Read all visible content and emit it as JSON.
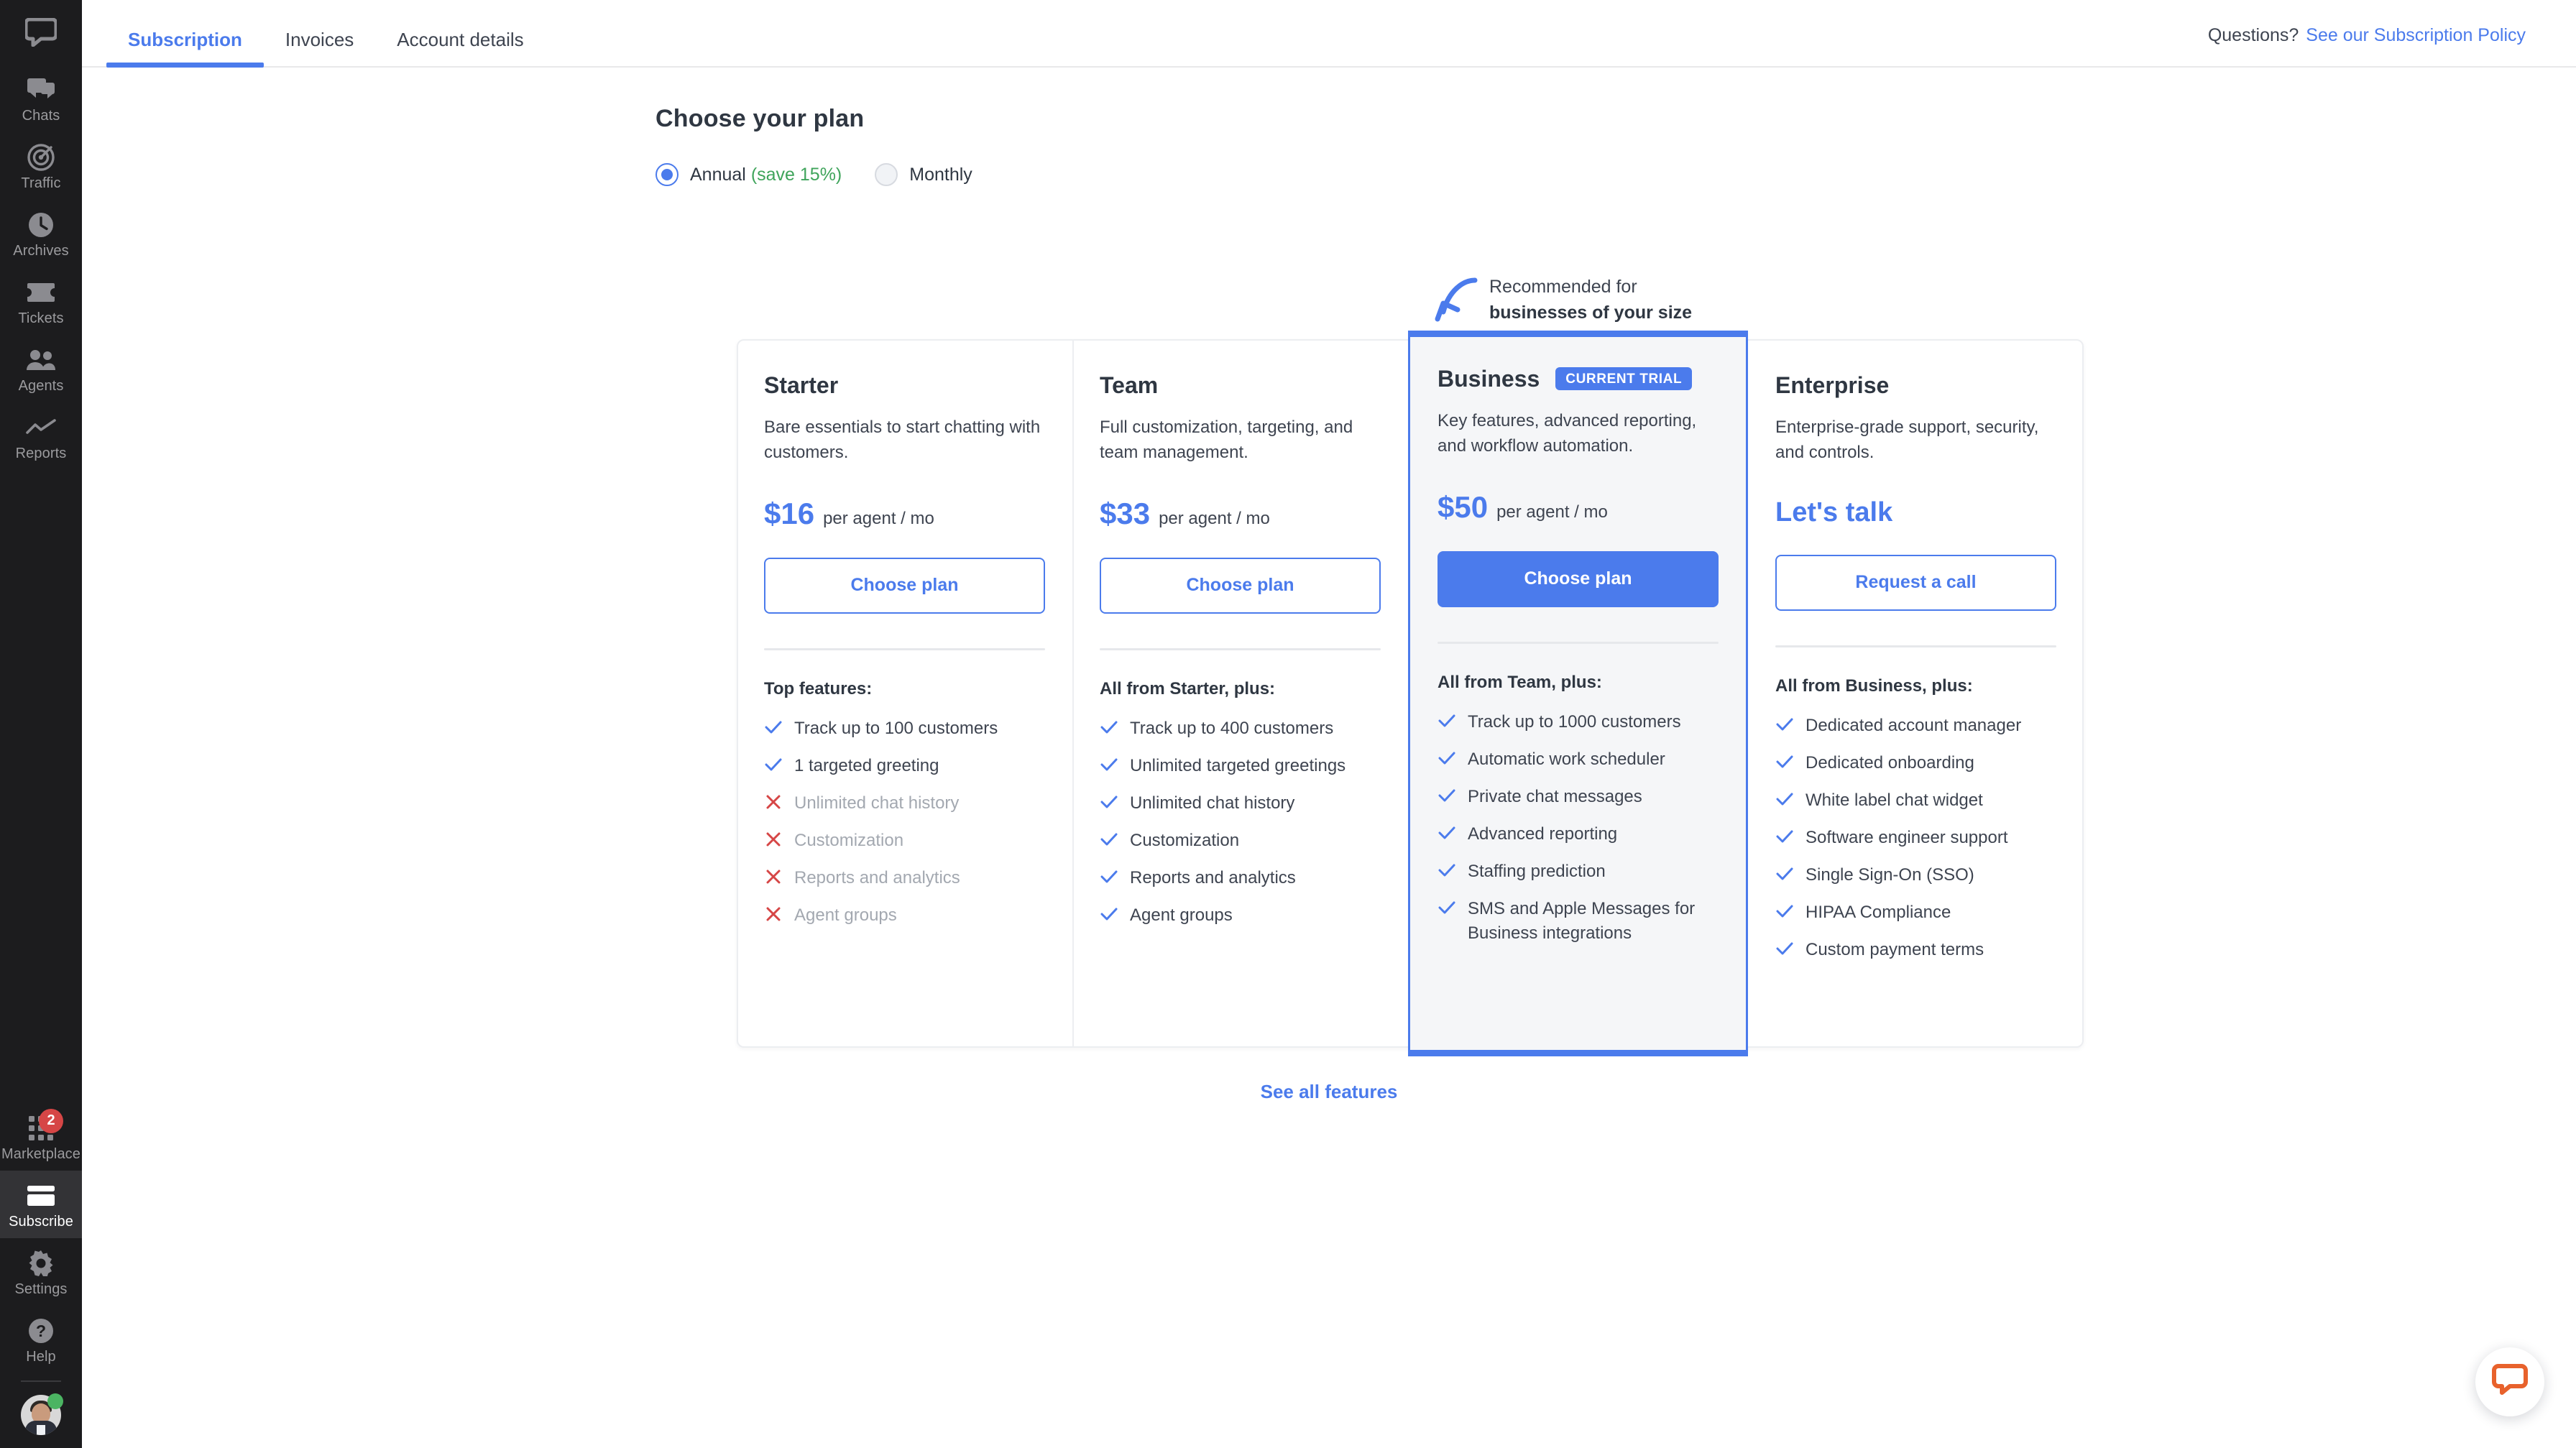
{
  "sidebar": {
    "logo_icon": "livechat-logo-icon",
    "items": [
      {
        "label": "Chats",
        "icon": "chats-icon",
        "active": false
      },
      {
        "label": "Traffic",
        "icon": "traffic-icon",
        "active": false
      },
      {
        "label": "Archives",
        "icon": "archives-clock-icon",
        "active": false
      },
      {
        "label": "Tickets",
        "icon": "tickets-icon",
        "active": false
      },
      {
        "label": "Agents",
        "icon": "agents-icon",
        "active": false
      },
      {
        "label": "Reports",
        "icon": "reports-chart-icon",
        "active": false
      }
    ],
    "bottom_items": [
      {
        "label": "Marketplace",
        "icon": "marketplace-grid-icon",
        "active": false,
        "badge": "2"
      },
      {
        "label": "Subscribe",
        "icon": "subscribe-card-icon",
        "active": true,
        "badge": ""
      },
      {
        "label": "Settings",
        "icon": "settings-gear-icon",
        "active": false,
        "badge": ""
      },
      {
        "label": "Help",
        "icon": "help-question-icon",
        "active": false,
        "badge": ""
      }
    ],
    "avatar_name": "user-avatar",
    "status": "online"
  },
  "topbar": {
    "tabs": [
      {
        "label": "Subscription",
        "active": true
      },
      {
        "label": "Invoices",
        "active": false
      },
      {
        "label": "Account details",
        "active": false
      }
    ],
    "questions_text": "Questions?",
    "policy_link": "See our Subscription Policy"
  },
  "page": {
    "title": "Choose your plan",
    "billing": {
      "annual_label": "Annual",
      "annual_note": "(save 15%)",
      "annual_selected": true,
      "monthly_label": "Monthly",
      "monthly_selected": false
    },
    "recommendation": {
      "line1": "Recommended for",
      "line2": "businesses of your size"
    },
    "see_all_features": "See all features"
  },
  "plans": [
    {
      "name": "Starter",
      "badge": "",
      "description": "Bare essentials to start chatting with customers.",
      "price": "$16",
      "price_unit": "per agent / mo",
      "contact_label": "",
      "cta": "Choose plan",
      "cta_primary": false,
      "featured": false,
      "features_title": "Top features:",
      "features": [
        {
          "text": "Track up to 100 customers",
          "included": true
        },
        {
          "text": "1 targeted greeting",
          "included": true
        },
        {
          "text": "Unlimited chat history",
          "included": false
        },
        {
          "text": "Customization",
          "included": false
        },
        {
          "text": "Reports and analytics",
          "included": false
        },
        {
          "text": "Agent groups",
          "included": false
        }
      ]
    },
    {
      "name": "Team",
      "badge": "",
      "description": "Full customization, targeting, and team management.",
      "price": "$33",
      "price_unit": "per agent / mo",
      "contact_label": "",
      "cta": "Choose plan",
      "cta_primary": false,
      "featured": false,
      "features_title": "All from Starter, plus:",
      "features": [
        {
          "text": "Track up to 400 customers",
          "included": true
        },
        {
          "text": "Unlimited targeted greetings",
          "included": true
        },
        {
          "text": "Unlimited chat history",
          "included": true
        },
        {
          "text": "Customization",
          "included": true
        },
        {
          "text": "Reports and analytics",
          "included": true
        },
        {
          "text": "Agent groups",
          "included": true
        }
      ]
    },
    {
      "name": "Business",
      "badge": "CURRENT TRIAL",
      "description": "Key features, advanced reporting, and workflow automation.",
      "price": "$50",
      "price_unit": "per agent / mo",
      "contact_label": "",
      "cta": "Choose plan",
      "cta_primary": true,
      "featured": true,
      "features_title": "All from Team, plus:",
      "features": [
        {
          "text": "Track up to 1000 customers",
          "included": true
        },
        {
          "text": "Automatic work scheduler",
          "included": true
        },
        {
          "text": "Private chat messages",
          "included": true
        },
        {
          "text": "Advanced reporting",
          "included": true
        },
        {
          "text": "Staffing prediction",
          "included": true
        },
        {
          "text": "SMS and Apple Messages for Business integrations",
          "included": true
        }
      ]
    },
    {
      "name": "Enterprise",
      "badge": "",
      "description": "Enterprise-grade support, security, and controls.",
      "price": "",
      "price_unit": "",
      "contact_label": "Let's talk",
      "cta": "Request a call",
      "cta_primary": false,
      "featured": false,
      "features_title": "All from Business, plus:",
      "features": [
        {
          "text": "Dedicated account manager",
          "included": true
        },
        {
          "text": "Dedicated onboarding",
          "included": true
        },
        {
          "text": "White label chat widget",
          "included": true
        },
        {
          "text": "Software engineer support",
          "included": true
        },
        {
          "text": "Single Sign-On (SSO)",
          "included": true
        },
        {
          "text": "HIPAA Compliance",
          "included": true
        },
        {
          "text": "Custom payment terms",
          "included": true
        }
      ]
    }
  ],
  "chat_launcher": {
    "icon": "chat-bubble-icon"
  },
  "colors": {
    "accent": "#4b7bec",
    "sidebar_bg": "#1c1c1e",
    "badge_red": "#d64646",
    "save_green": "#3fa45b",
    "featured_bg": "#f5f6f8",
    "chat_orange": "#e8622c"
  }
}
